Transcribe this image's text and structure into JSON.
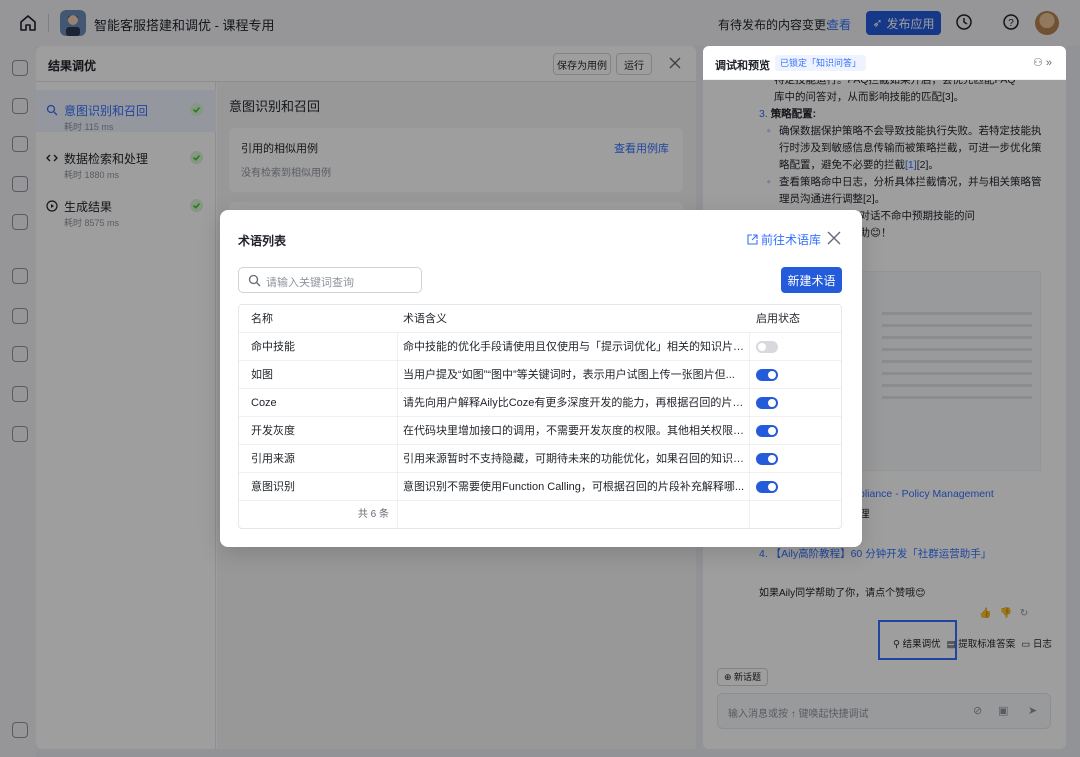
{
  "topbar": {
    "app_title": "智能客服搭建和调优 - 课程专用",
    "pending_label": "有待发布的内容变更:",
    "view_link": "查看",
    "publish_label": "发布应用"
  },
  "result_panel": {
    "title": "结果调优",
    "save_as_case": "保存为用例",
    "run": "运行",
    "steps": [
      {
        "label": "意图识别和召回",
        "time": "耗时 115 ms"
      },
      {
        "label": "数据检索和处理",
        "time": "耗时 1880 ms"
      },
      {
        "label": "生成结果",
        "time": "耗时 8575 ms"
      }
    ],
    "detail_title": "意图识别和召回",
    "similar_title": "引用的相似用例",
    "similar_link": "查看用例库",
    "similar_empty": "没有检索到相似用例"
  },
  "preview": {
    "title": "调试和预览",
    "badge": "已锁定「知识问答」",
    "chat_line1": "特定技能运行。FAQ拦截如果开启，会优先匹配FAQ",
    "chat_line2": "库中的问答对，从而影响技能的匹配[3]。",
    "strategy_num": "3.",
    "strategy_title": "策略配置:",
    "bullet1": "确保数据保护策略不会导致技能执行失败。若特定技能执行时涉及到敏感信息传输而被策略拦截，可进一步优化策略配置，避免不必要的拦截",
    "bullet1_ref": "[1]",
    "bullet1_tail": "[2]。",
    "bullet2": "查看策略命中日志，分析具体拦截情况，并与相关策略管理员沟通进行调整[2]。",
    "partial1": "减少或避免对话不命中预期技能的问",
    "partial2": "对您有所帮助😊！",
    "ref_partial": "pliance - Policy Management",
    "ref_partial2": "理",
    "ref_partial3": ")",
    "ref4": "4. 【Aily高阶教程】60 分钟开发「社群运营助手」",
    "thanks": "如果Aily同学帮助了你，请点个赞哦😊",
    "actions": [
      "结果调优",
      "提取标准答案",
      "日志"
    ],
    "new_topic": "新话题",
    "input_placeholder": "输入消息或按 ↑ 键唤起快捷调试"
  },
  "modal": {
    "title": "术语列表",
    "goto_library": "前往术语库",
    "search_placeholder": "请输入关键词查询",
    "new_term": "新建术语",
    "columns": [
      "名称",
      "术语含义",
      "启用状态"
    ],
    "rows": [
      {
        "name": "命中技能",
        "meaning": "命中技能的优化手段请使用且仅使用与「提示词优化」相关的知识片段...",
        "enabled": false
      },
      {
        "name": "如图",
        "meaning": "当用户提及“如图”“图中”等关键词时，表示用户试图上传一张图片但...",
        "enabled": true
      },
      {
        "name": "Coze",
        "meaning": "请先向用户解释Aily比Coze有更多深度开发的能力，再根据召回的片段...",
        "enabled": true
      },
      {
        "name": "开发灰度",
        "meaning": "在代码块里增加接口的调用，不需要开发灰度的权限。其他相关权限可...",
        "enabled": true
      },
      {
        "name": "引用来源",
        "meaning": "引用来源暂时不支持隐藏，可期待未来的功能优化，如果召回的知识中...",
        "enabled": true
      },
      {
        "name": "意图识别",
        "meaning": "意图识别不需要使用Function Calling，可根据召回的片段补充解释哪...",
        "enabled": true
      }
    ],
    "total": "共 6 条"
  },
  "colors": {
    "accent": "#245bdb",
    "link": "#3370ff",
    "success": "#34c724"
  }
}
